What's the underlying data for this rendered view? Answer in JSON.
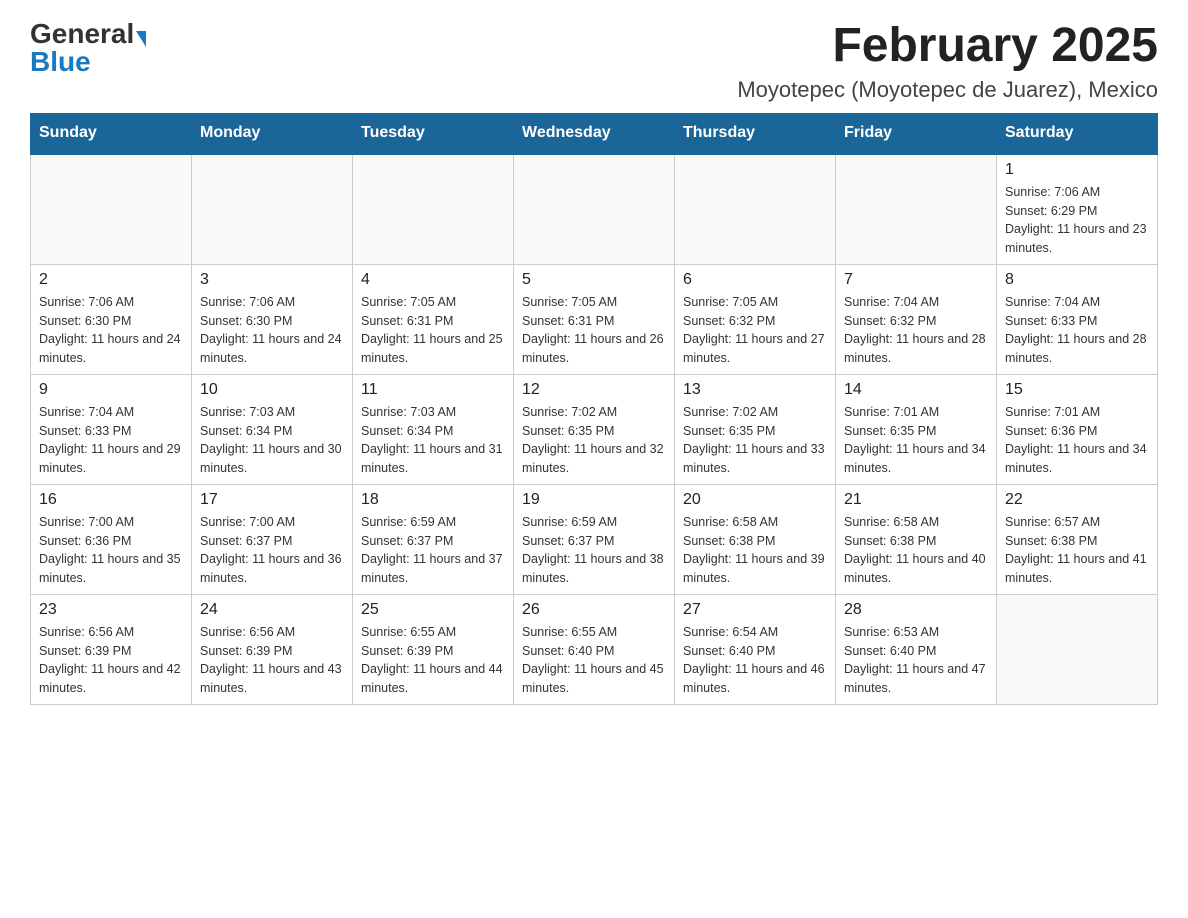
{
  "logo": {
    "general": "General",
    "blue": "Blue"
  },
  "title": "February 2025",
  "location": "Moyotepec (Moyotepec de Juarez), Mexico",
  "weekdays": [
    "Sunday",
    "Monday",
    "Tuesday",
    "Wednesday",
    "Thursday",
    "Friday",
    "Saturday"
  ],
  "weeks": [
    [
      {
        "day": "",
        "info": ""
      },
      {
        "day": "",
        "info": ""
      },
      {
        "day": "",
        "info": ""
      },
      {
        "day": "",
        "info": ""
      },
      {
        "day": "",
        "info": ""
      },
      {
        "day": "",
        "info": ""
      },
      {
        "day": "1",
        "info": "Sunrise: 7:06 AM\nSunset: 6:29 PM\nDaylight: 11 hours and 23 minutes."
      }
    ],
    [
      {
        "day": "2",
        "info": "Sunrise: 7:06 AM\nSunset: 6:30 PM\nDaylight: 11 hours and 24 minutes."
      },
      {
        "day": "3",
        "info": "Sunrise: 7:06 AM\nSunset: 6:30 PM\nDaylight: 11 hours and 24 minutes."
      },
      {
        "day": "4",
        "info": "Sunrise: 7:05 AM\nSunset: 6:31 PM\nDaylight: 11 hours and 25 minutes."
      },
      {
        "day": "5",
        "info": "Sunrise: 7:05 AM\nSunset: 6:31 PM\nDaylight: 11 hours and 26 minutes."
      },
      {
        "day": "6",
        "info": "Sunrise: 7:05 AM\nSunset: 6:32 PM\nDaylight: 11 hours and 27 minutes."
      },
      {
        "day": "7",
        "info": "Sunrise: 7:04 AM\nSunset: 6:32 PM\nDaylight: 11 hours and 28 minutes."
      },
      {
        "day": "8",
        "info": "Sunrise: 7:04 AM\nSunset: 6:33 PM\nDaylight: 11 hours and 28 minutes."
      }
    ],
    [
      {
        "day": "9",
        "info": "Sunrise: 7:04 AM\nSunset: 6:33 PM\nDaylight: 11 hours and 29 minutes."
      },
      {
        "day": "10",
        "info": "Sunrise: 7:03 AM\nSunset: 6:34 PM\nDaylight: 11 hours and 30 minutes."
      },
      {
        "day": "11",
        "info": "Sunrise: 7:03 AM\nSunset: 6:34 PM\nDaylight: 11 hours and 31 minutes."
      },
      {
        "day": "12",
        "info": "Sunrise: 7:02 AM\nSunset: 6:35 PM\nDaylight: 11 hours and 32 minutes."
      },
      {
        "day": "13",
        "info": "Sunrise: 7:02 AM\nSunset: 6:35 PM\nDaylight: 11 hours and 33 minutes."
      },
      {
        "day": "14",
        "info": "Sunrise: 7:01 AM\nSunset: 6:35 PM\nDaylight: 11 hours and 34 minutes."
      },
      {
        "day": "15",
        "info": "Sunrise: 7:01 AM\nSunset: 6:36 PM\nDaylight: 11 hours and 34 minutes."
      }
    ],
    [
      {
        "day": "16",
        "info": "Sunrise: 7:00 AM\nSunset: 6:36 PM\nDaylight: 11 hours and 35 minutes."
      },
      {
        "day": "17",
        "info": "Sunrise: 7:00 AM\nSunset: 6:37 PM\nDaylight: 11 hours and 36 minutes."
      },
      {
        "day": "18",
        "info": "Sunrise: 6:59 AM\nSunset: 6:37 PM\nDaylight: 11 hours and 37 minutes."
      },
      {
        "day": "19",
        "info": "Sunrise: 6:59 AM\nSunset: 6:37 PM\nDaylight: 11 hours and 38 minutes."
      },
      {
        "day": "20",
        "info": "Sunrise: 6:58 AM\nSunset: 6:38 PM\nDaylight: 11 hours and 39 minutes."
      },
      {
        "day": "21",
        "info": "Sunrise: 6:58 AM\nSunset: 6:38 PM\nDaylight: 11 hours and 40 minutes."
      },
      {
        "day": "22",
        "info": "Sunrise: 6:57 AM\nSunset: 6:38 PM\nDaylight: 11 hours and 41 minutes."
      }
    ],
    [
      {
        "day": "23",
        "info": "Sunrise: 6:56 AM\nSunset: 6:39 PM\nDaylight: 11 hours and 42 minutes."
      },
      {
        "day": "24",
        "info": "Sunrise: 6:56 AM\nSunset: 6:39 PM\nDaylight: 11 hours and 43 minutes."
      },
      {
        "day": "25",
        "info": "Sunrise: 6:55 AM\nSunset: 6:39 PM\nDaylight: 11 hours and 44 minutes."
      },
      {
        "day": "26",
        "info": "Sunrise: 6:55 AM\nSunset: 6:40 PM\nDaylight: 11 hours and 45 minutes."
      },
      {
        "day": "27",
        "info": "Sunrise: 6:54 AM\nSunset: 6:40 PM\nDaylight: 11 hours and 46 minutes."
      },
      {
        "day": "28",
        "info": "Sunrise: 6:53 AM\nSunset: 6:40 PM\nDaylight: 11 hours and 47 minutes."
      },
      {
        "day": "",
        "info": ""
      }
    ]
  ]
}
